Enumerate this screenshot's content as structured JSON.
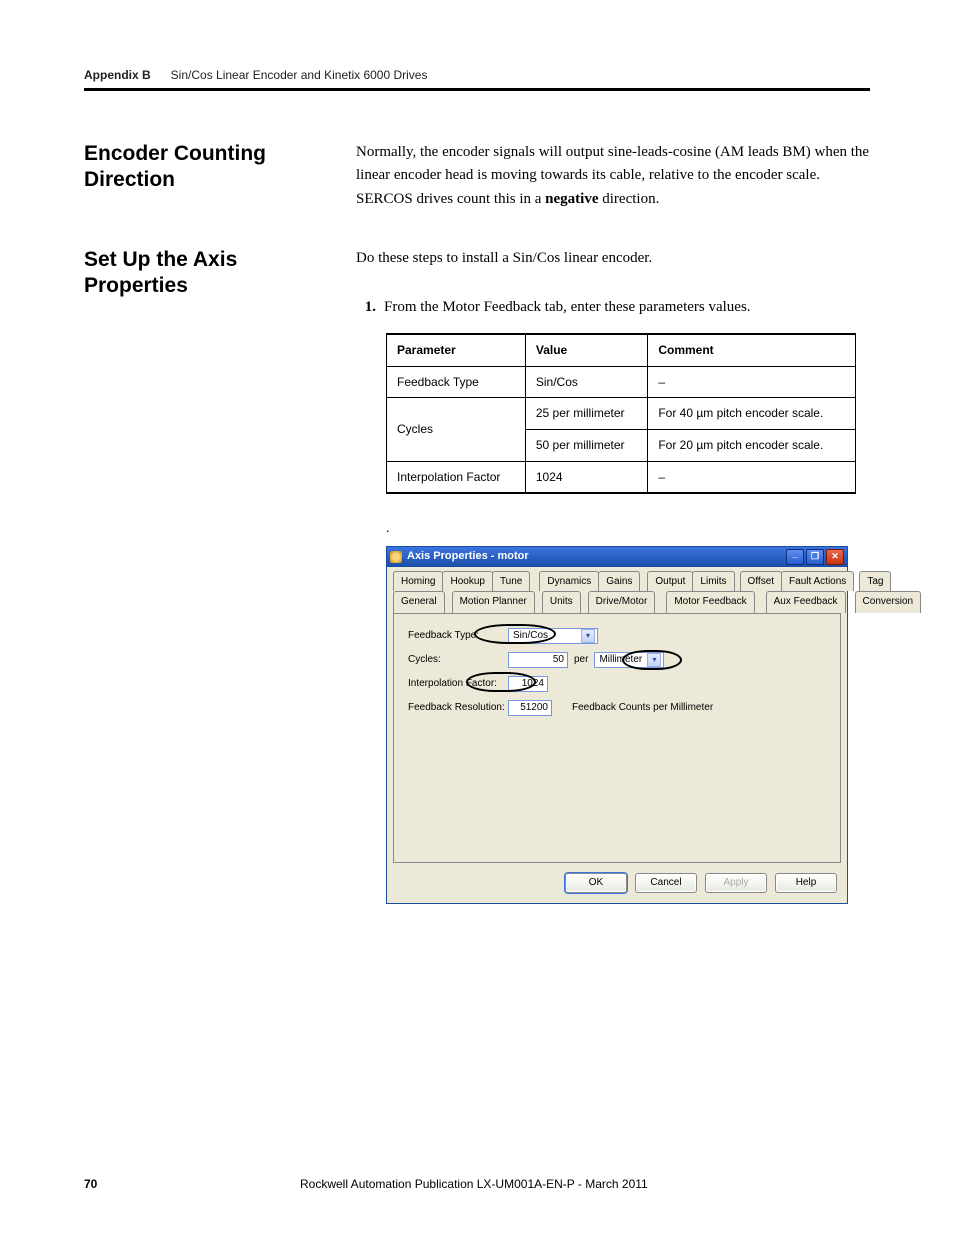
{
  "header": {
    "appendix": "Appendix B",
    "title": "Sin/Cos Linear Encoder and Kinetix 6000 Drives"
  },
  "sections": {
    "encoder": {
      "title": "Encoder Counting Direction",
      "body_pre": "Normally, the encoder signals will output sine-leads-cosine (AM leads BM) when the linear encoder head is moving towards its cable, relative to the encoder scale. SERCOS drives count this in a ",
      "body_bold": "negative",
      "body_post": " direction."
    },
    "setup": {
      "title": "Set Up the Axis Properties",
      "intro": "Do these steps to install a Sin/Cos linear encoder.",
      "step1_num": "1.",
      "step1": "From the Motor Feedback tab, enter these parameters values."
    }
  },
  "table": {
    "headers": {
      "p": "Parameter",
      "v": "Value",
      "c": "Comment"
    },
    "r1": {
      "p": "Feedback Type",
      "v": "Sin/Cos",
      "c": "–"
    },
    "r2p": "Cycles",
    "r2a": {
      "v": "25 per millimeter",
      "c": "For 40 µm pitch encoder scale."
    },
    "r2b": {
      "v": "50 per millimeter",
      "c": "For 20 µm pitch encoder scale."
    },
    "r3": {
      "p": "Interpolation Factor",
      "v": "1024",
      "c": "–"
    }
  },
  "dialog": {
    "title": "Axis Properties - motor",
    "tabs_top": [
      "Homing",
      "Hookup",
      "Tune",
      "Dynamics",
      "Gains",
      "Output",
      "Limits",
      "Offset",
      "Fault Actions",
      "Tag"
    ],
    "tabs_bottom": [
      "General",
      "Motion Planner",
      "Units",
      "Drive/Motor",
      "Motor Feedback",
      "Aux Feedback",
      "Conversion"
    ],
    "labels": {
      "feedback_type": "Feedback Type:",
      "cycles": "Cycles:",
      "per": "per",
      "interp": "Interpolation Factor:",
      "res": "Feedback Resolution:",
      "res_units": "Feedback Counts per Millimeter"
    },
    "values": {
      "feedback_type": "Sin/Cos",
      "cycles": "50",
      "cycles_unit": "Millimeter",
      "interp": "1024",
      "res": "51200"
    },
    "buttons": {
      "ok": "OK",
      "cancel": "Cancel",
      "apply": "Apply",
      "help": "Help"
    }
  },
  "footer": {
    "page": "70",
    "pub": "Rockwell Automation Publication LX-UM001A-EN-P - March 2011"
  },
  "dot": "."
}
